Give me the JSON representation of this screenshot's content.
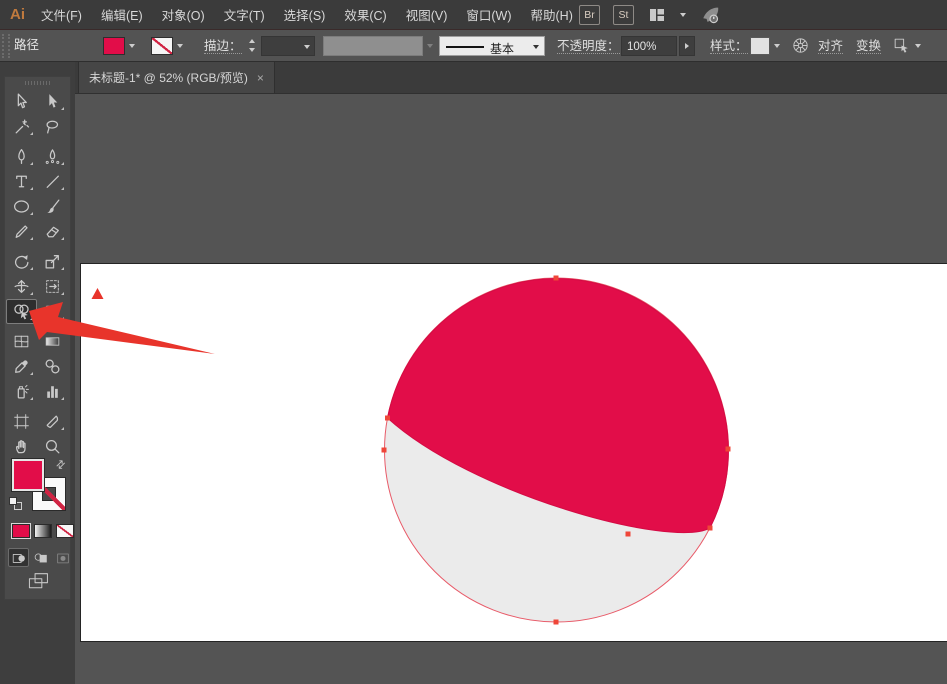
{
  "menubar": {
    "logo": "Ai",
    "items": [
      {
        "label": "文件(F)"
      },
      {
        "label": "编辑(E)"
      },
      {
        "label": "对象(O)"
      },
      {
        "label": "文字(T)"
      },
      {
        "label": "选择(S)"
      },
      {
        "label": "效果(C)"
      },
      {
        "label": "视图(V)"
      },
      {
        "label": "窗口(W)"
      },
      {
        "label": "帮助(H)"
      }
    ],
    "bridge_badge": "Br",
    "stock_badge": "St"
  },
  "controlbar": {
    "selection_type_label": "路径",
    "stroke_label": "描边：",
    "stroke_width_value": "",
    "width_profile_value": "基本",
    "opacity_label": "不透明度：",
    "opacity_value": "100%",
    "style_label": "样式：",
    "align_label": "对齐",
    "transform_label": "变换"
  },
  "tabbar": {
    "collapse_glyph": "«",
    "tab_title": "未标题-1* @ 52% (RGB/预览)",
    "close_glyph": "×"
  },
  "toolbar": {
    "selected_tool": "shape-builder-tool"
  },
  "colors": {
    "shape_fill_red": "#E20D49",
    "shape_lower_gray": "#EBEBEB",
    "selection_outline_red": "#E85A68",
    "anchor_red": "#EF4638",
    "annotation_red": "#E8342B",
    "fill_swatch_red": "#E20D49"
  }
}
